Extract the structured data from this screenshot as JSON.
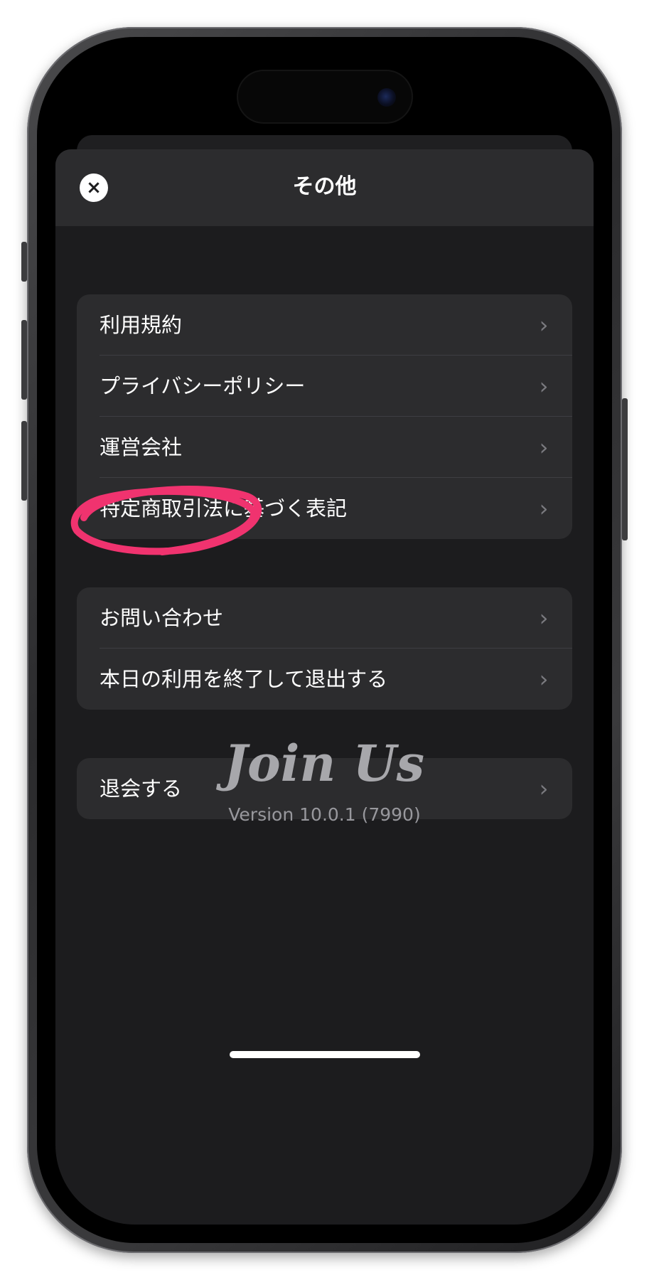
{
  "navbar": {
    "title": "その他",
    "close_icon": "×"
  },
  "groups": [
    {
      "items": [
        {
          "label": "利用規約"
        },
        {
          "label": "プライバシーポリシー"
        },
        {
          "label": "運営会社"
        },
        {
          "label": "特定商取引法に基づく表記"
        }
      ]
    },
    {
      "items": [
        {
          "label": "お問い合わせ"
        },
        {
          "label": "本日の利用を終了して退出する"
        }
      ]
    },
    {
      "items": [
        {
          "label": "退会する"
        }
      ]
    }
  ],
  "chevron_glyph": "›",
  "footer": {
    "logo_text": "Join Us",
    "version": "Version 10.0.1 (7990)"
  },
  "colors": {
    "background": "#1c1c1e",
    "cell": "#2c2c2e",
    "annotation": "#f0336f"
  }
}
